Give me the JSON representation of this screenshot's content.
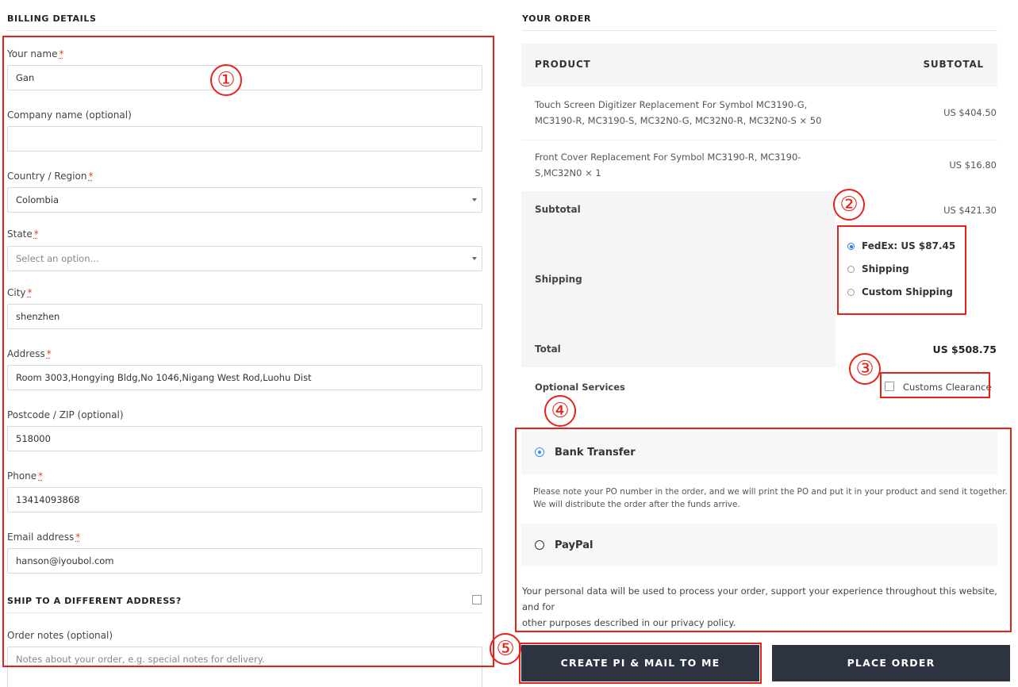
{
  "billing": {
    "heading": "BILLING DETAILS",
    "fields": {
      "name": {
        "label": "Your name",
        "value": "Gan"
      },
      "company": {
        "label": "Company name (optional)",
        "value": ""
      },
      "country": {
        "label": "Country / Region",
        "value": "Colombia"
      },
      "state": {
        "label": "State",
        "value": "Select an option…"
      },
      "city": {
        "label": "City",
        "value": "shenzhen"
      },
      "address": {
        "label": "Address",
        "value": "Room 3003,Hongying Bldg,No 1046,Nigang West Rod,Luohu Dist"
      },
      "postcode": {
        "label": "Postcode / ZIP  (optional)",
        "value": "518000"
      },
      "phone": {
        "label": "Phone",
        "value": "13414093868"
      },
      "email": {
        "label": "Email address",
        "value": "hanson@iyoubol.com"
      }
    },
    "required_mark": "*",
    "ship_different": "SHIP TO A DIFFERENT ADDRESS?",
    "order_notes": {
      "label": "Order notes (optional)",
      "placeholder": "Notes about your order, e.g. special notes for delivery."
    }
  },
  "order": {
    "heading": "YOUR ORDER",
    "col_product": "PRODUCT",
    "col_subtotal": "SUBTOTAL",
    "items": [
      {
        "line1": "Touch Screen Digitizer Replacement For Symbol MC3190-G,",
        "line2": "MC3190-R, MC3190-S, MC32N0-G, MC32N0-R, MC32N0-S  × 50",
        "price": "US $404.50"
      },
      {
        "line1": "Front Cover Replacement For Symbol MC3190-R, MC3190-",
        "line2": "S,MC32N0  × 1",
        "price": "US $16.80"
      }
    ],
    "subtotal_label": "Subtotal",
    "subtotal_value": "US $421.30",
    "shipping_label": "Shipping",
    "shipping_options": [
      "FedEx: US $87.45",
      "Shipping",
      "Custom Shipping"
    ],
    "total_label": "Total",
    "total_value": "US $508.75",
    "optional_services_label": "Optional Services",
    "customs_clearance": "Customs Clearance"
  },
  "payment": {
    "bank_transfer": "Bank Transfer",
    "bank_note_1": "Please note your PO number in the order, and we will print the PO and put it in your product and send it together.",
    "bank_note_2": "We will distribute the order after the funds arrive.",
    "paypal": "PayPal",
    "privacy_1": "Your personal data will be used to process your order, support your experience throughout this website, and for",
    "privacy_2": "other purposes described in our privacy policy."
  },
  "buttons": {
    "create_pi": "CREATE PI & MAIL TO ME",
    "place_order": "PLACE ORDER"
  },
  "annotations": [
    "①",
    "②",
    "③",
    "④",
    "⑤"
  ],
  "colors": {
    "accent_red": "#e8211a",
    "button_dark": "#2e3341",
    "radio_blue": "#2d7be5"
  }
}
